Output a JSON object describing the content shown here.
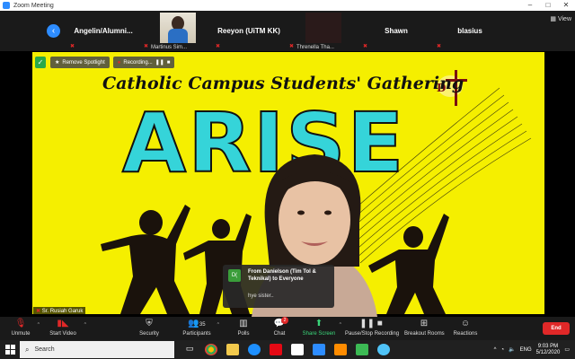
{
  "window": {
    "title": "Zoom Meeting",
    "controls": [
      "–",
      "□",
      "✕"
    ]
  },
  "gallery": {
    "view_label": "View",
    "tiles": [
      {
        "name": "Angelin/Alumni...",
        "muted": true
      },
      {
        "name": "",
        "caption": "Martinus Sim...",
        "muted": true,
        "has_video": true
      },
      {
        "name": "Reeyon (UiTM KK)",
        "muted": true
      },
      {
        "name": "",
        "caption": "Threnella Tha...",
        "muted": true,
        "has_video": true
      },
      {
        "name": "Shawn",
        "muted": true
      },
      {
        "name": "blasius",
        "muted": true
      }
    ]
  },
  "main": {
    "spotlight_button": "Remove Spotlight",
    "recording_label": "Recording...",
    "slide_heading": "Catholic Campus Students' Gathering",
    "slide_word": "ARISE",
    "speaker_name": "Sr. Rusiah Garuk"
  },
  "chat_popup": {
    "avatar_initials": "D(",
    "from": "From Danielson (Tim Tol & Teknikal) to Everyone",
    "message": "hye sister.."
  },
  "toolbar": {
    "items": [
      {
        "label": "Unmute",
        "icon": "mic-muted-icon"
      },
      {
        "label": "Start Video",
        "icon": "video-off-icon"
      },
      {
        "label": "Security",
        "icon": "shield-icon"
      },
      {
        "label": "Participants",
        "icon": "participants-icon",
        "count": "35"
      },
      {
        "label": "Polls",
        "icon": "polls-icon"
      },
      {
        "label": "Chat",
        "icon": "chat-icon",
        "badge": "2"
      },
      {
        "label": "Share Screen",
        "icon": "share-screen-icon"
      },
      {
        "label": "Pause/Stop Recording",
        "icon": "recording-icon"
      },
      {
        "label": "Breakout Rooms",
        "icon": "breakout-icon"
      },
      {
        "label": "Reactions",
        "icon": "reactions-icon"
      }
    ],
    "end_label": "End"
  },
  "taskbar": {
    "search_placeholder": "Search",
    "language": "ENG",
    "time": "9:03 PM",
    "date": "5/12/2020"
  },
  "colors": {
    "zoom_blue": "#2d8cff",
    "slide_yellow": "#f5ef00",
    "arise_teal": "#35d4d9",
    "end_red": "#e02828"
  }
}
